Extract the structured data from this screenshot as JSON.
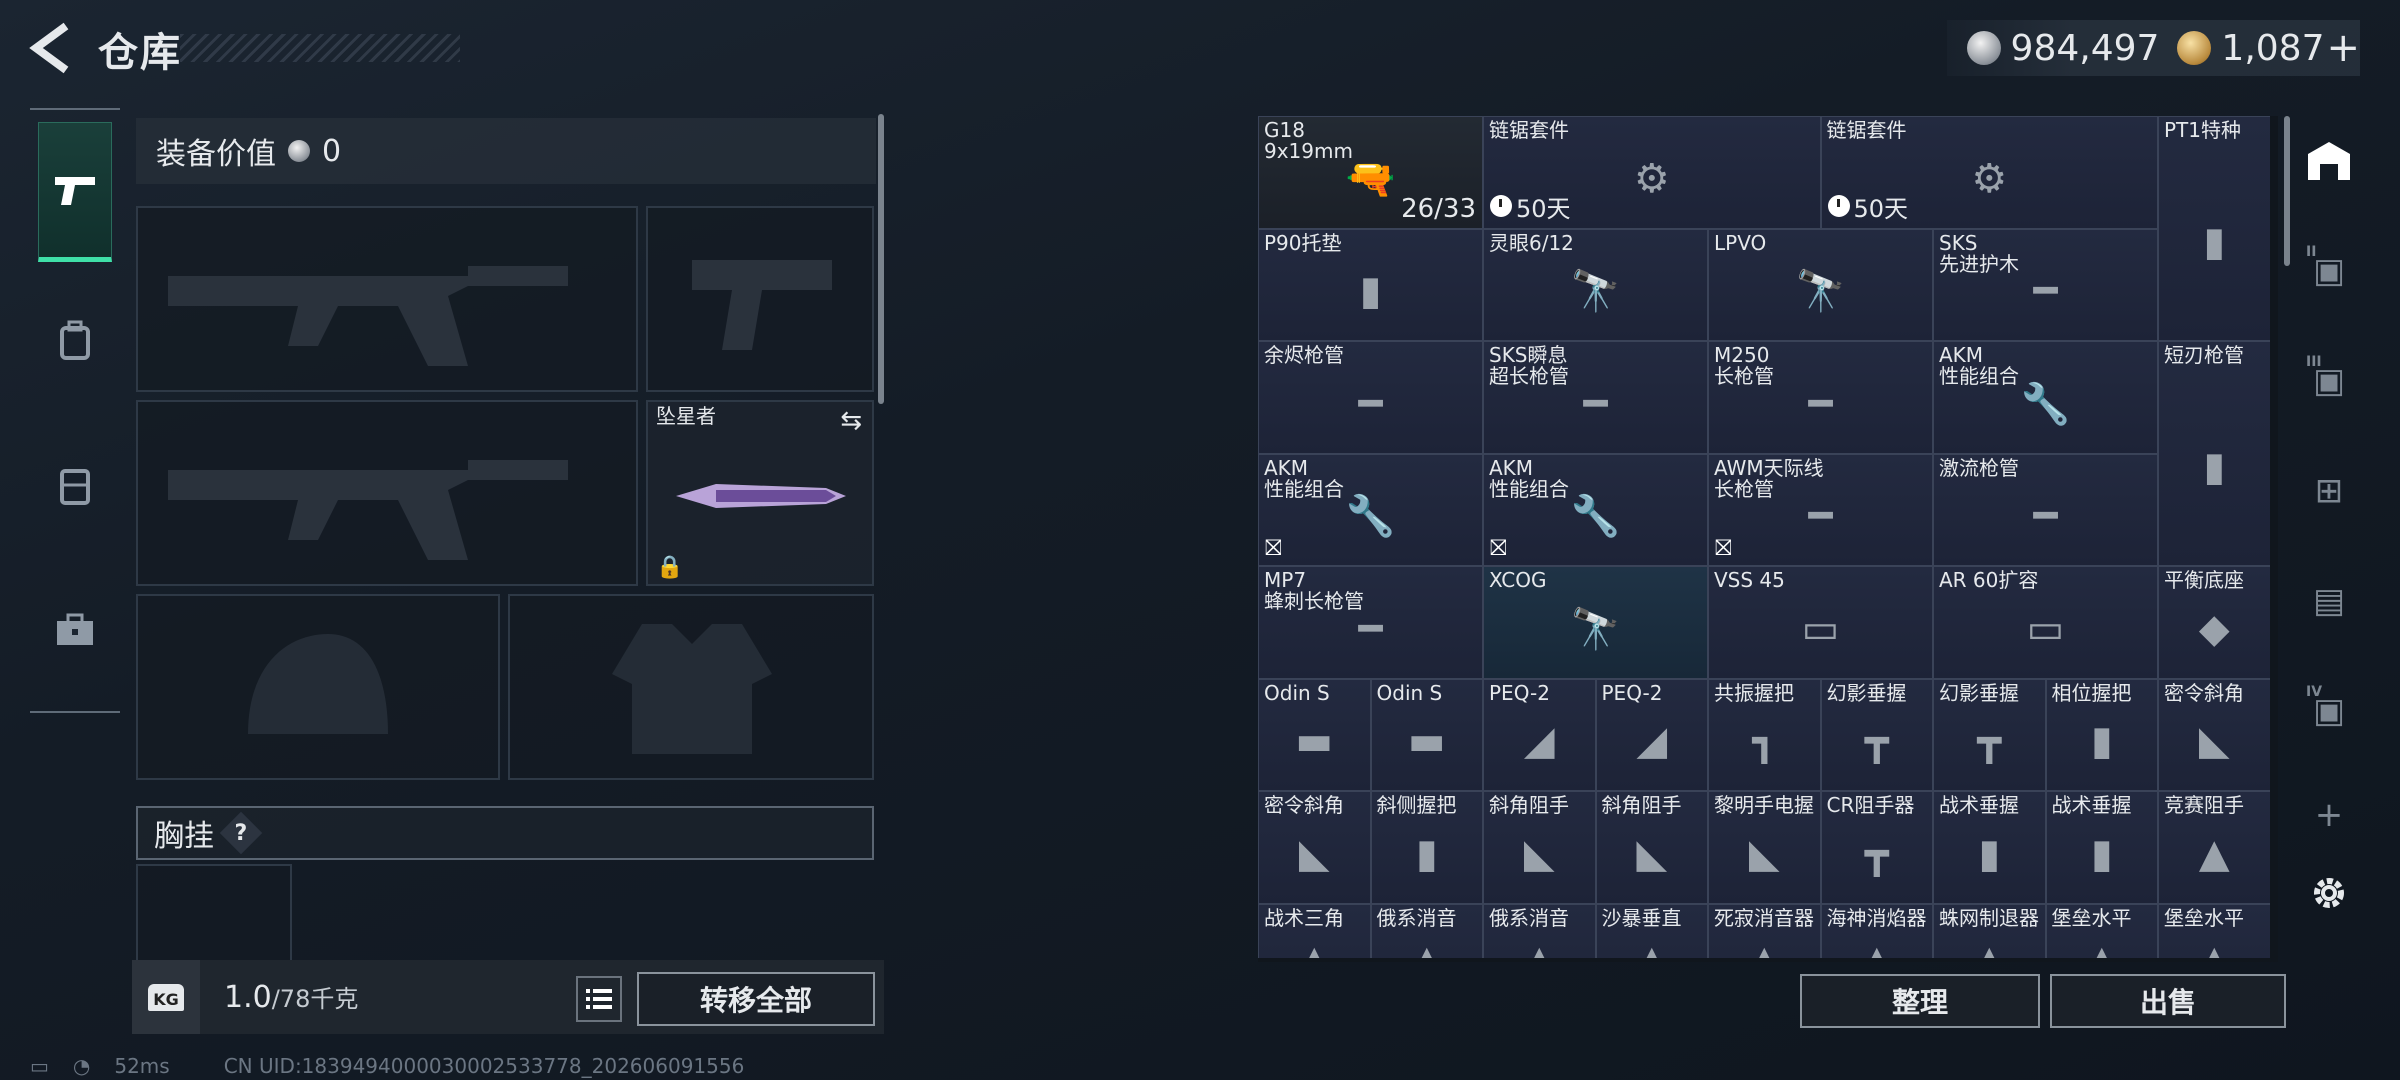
{
  "header": {
    "title": "仓库",
    "currency_silver": "984,497",
    "currency_gold": "1,087",
    "plus": "+"
  },
  "left_nav": [
    "weapon-icon",
    "backpack-icon",
    "vest-icon",
    "toolbox-icon"
  ],
  "loadout": {
    "equip_label": "装备价值",
    "equip_value": "0",
    "melee_name": "坠星者",
    "chest_label": "胸挂",
    "chest_help": "?",
    "weight_unit_icon": "KG",
    "weight_current": "1.0",
    "weight_max": "/78千克",
    "transfer_all": "转移全部"
  },
  "inventory": {
    "items": [
      {
        "name": "G18\n9x19mm",
        "ammo": "26/33",
        "icon": "🔫"
      },
      {
        "name": "链锯套件",
        "timer": "50天",
        "icon": "⚙"
      },
      {
        "name": "链锯套件",
        "timer": "50天",
        "icon": "⚙"
      },
      {
        "name": "PT1特种",
        "icon": "▮"
      },
      {
        "name": "P90托垫",
        "icon": "▮"
      },
      {
        "name": "灵眼6/12",
        "icon": "🔭"
      },
      {
        "name": "LPVO",
        "icon": "🔭"
      },
      {
        "name": "SKS\n先进护木",
        "icon": "━"
      },
      {
        "name": "余烬枪管",
        "icon": "━"
      },
      {
        "name": "SKS瞬息\n超长枪管",
        "icon": "━"
      },
      {
        "name": "M250\n长枪管",
        "icon": "━"
      },
      {
        "name": "AKM\n性能组合",
        "icon": "🔧"
      },
      {
        "name": "短刃枪管",
        "icon": "▮"
      },
      {
        "name": "AKM\n性能组合",
        "icon": "🔧",
        "nobind": "⛝"
      },
      {
        "name": "AKM\n性能组合",
        "icon": "🔧",
        "nobind": "⛝"
      },
      {
        "name": "AWM天际线\n长枪管",
        "icon": "━",
        "nobind": "⛝"
      },
      {
        "name": "激流枪管",
        "icon": "━"
      },
      {
        "name": "MP7\n蜂刺长枪管",
        "icon": "━"
      },
      {
        "name": "XCOG",
        "icon": "🔭"
      },
      {
        "name": "VSS 45",
        "icon": "▭"
      },
      {
        "name": "AR 60扩容",
        "icon": "▭"
      },
      {
        "name": "平衡底座",
        "icon": "◆"
      },
      {
        "name": "Odin S",
        "icon": "▬"
      },
      {
        "name": "Odin S",
        "icon": "▬"
      },
      {
        "name": "PEQ-2",
        "icon": "◢"
      },
      {
        "name": "PEQ-2",
        "icon": "◢"
      },
      {
        "name": "共振握把",
        "icon": "┓"
      },
      {
        "name": "幻影垂握",
        "icon": "┳"
      },
      {
        "name": "幻影垂握",
        "icon": "┳"
      },
      {
        "name": "相位握把",
        "icon": "▮"
      },
      {
        "name": "密令斜角",
        "icon": "◣"
      },
      {
        "name": "密令斜角",
        "icon": "◣"
      },
      {
        "name": "斜侧握把",
        "icon": "▮"
      },
      {
        "name": "斜角阻手",
        "icon": "◣"
      },
      {
        "name": "斜角阻手",
        "icon": "◣"
      },
      {
        "name": "黎明手电握",
        "icon": "◣"
      },
      {
        "name": "CR阻手器",
        "icon": "┳"
      },
      {
        "name": "战术垂握",
        "icon": "▮"
      },
      {
        "name": "战术垂握",
        "icon": "▮"
      },
      {
        "name": "竞赛阻手",
        "icon": "▲"
      },
      {
        "name": "战术三角",
        "icon": "▲"
      },
      {
        "name": "俄系消音",
        "icon": "▲"
      },
      {
        "name": "俄系消音",
        "icon": "▲"
      },
      {
        "name": "沙暴垂直",
        "icon": "▲"
      },
      {
        "name": "死寂消音器",
        "icon": "▲"
      },
      {
        "name": "海神消焰器",
        "icon": "▲"
      },
      {
        "name": "蛛网制退器",
        "icon": "▲"
      },
      {
        "name": "堡垒水平",
        "icon": "▲"
      },
      {
        "name": "堡垒水平",
        "icon": "▲"
      }
    ],
    "tidy": "整理",
    "sell": "出售"
  },
  "right_nav": [
    "safebox-icon",
    "case-II-icon",
    "case-III-icon",
    "medical-case-icon",
    "stack-case-icon",
    "case-IV-icon",
    "add-icon",
    "settings-icon"
  ],
  "status": {
    "ping": "52ms",
    "uid": "CN UID:1839494000030002533778_202606091556"
  }
}
